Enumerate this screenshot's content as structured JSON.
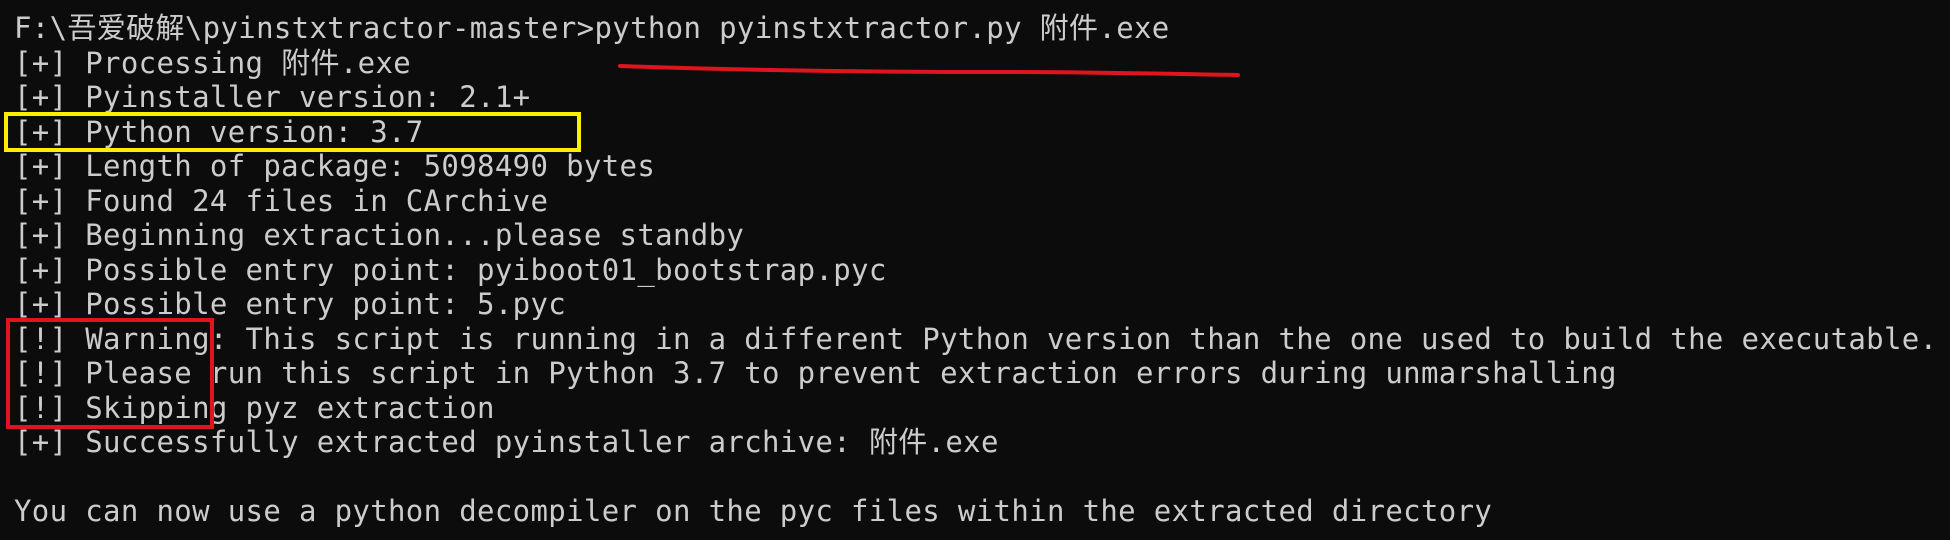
{
  "terminal": {
    "prompt_line": "F:\\吾爱破解\\pyinstxtractor-master>python pyinstxtractor.py 附件.exe",
    "output_lines": [
      "[+] Processing 附件.exe",
      "[+] Pyinstaller version: 2.1+",
      "[+] Python version: 3.7",
      "[+] Length of package: 5098490 bytes",
      "[+] Found 24 files in CArchive",
      "[+] Beginning extraction...please standby",
      "[+] Possible entry point: pyiboot01_bootstrap.pyc",
      "[+] Possible entry point: 5.pyc",
      "[!] Warning: This script is running in a different Python version than the one used to build the executable.",
      "[!] Please run this script in Python 3.7 to prevent extraction errors during unmarshalling",
      "[!] Skipping pyz extraction",
      "[+] Successfully extracted pyinstaller archive: 附件.exe"
    ],
    "final_line": "You can now use a python decompiler on the pyc files within the extracted directory"
  },
  "annotations": {
    "underline_color": "#e0141e",
    "yellow_box_color": "#ffee00",
    "red_box_color": "#e0141e"
  },
  "colors": {
    "background": "#0c0c0c",
    "text": "#cccccc"
  }
}
